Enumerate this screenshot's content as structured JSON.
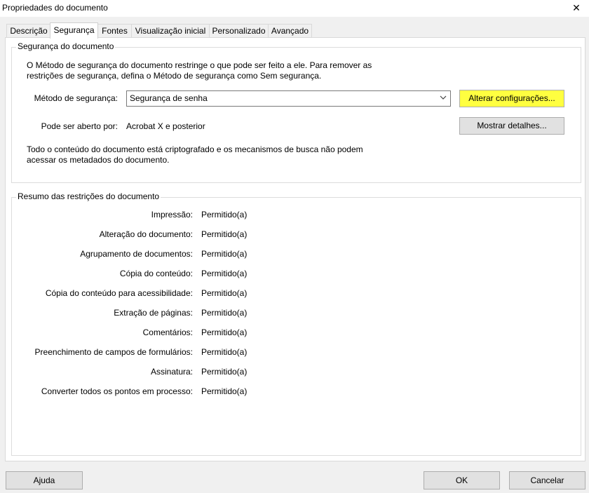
{
  "window": {
    "title": "Propriedades do documento",
    "close_glyph": "✕"
  },
  "tabs": [
    {
      "label": "Descrição"
    },
    {
      "label": "Segurança"
    },
    {
      "label": "Fontes"
    },
    {
      "label": "Visualização inicial"
    },
    {
      "label": "Personalizado"
    },
    {
      "label": "Avançado"
    }
  ],
  "security": {
    "group_title": "Segurança do documento",
    "description_line1": "O Método de segurança do documento restringe o que pode ser feito a ele. Para remover as",
    "description_line2": "restrições de segurança, defina o Método de segurança como Sem segurança.",
    "method_label": "Método de segurança:",
    "method_value": "Segurança de senha",
    "change_settings_label": "Alterar configurações...",
    "opened_by_label": "Pode ser aberto por:",
    "opened_by_value": "Acrobat X e posterior",
    "show_details_label": "Mostrar detalhes...",
    "encrypted_line1": "Todo o conteúdo do documento está criptografado e os mecanismos de busca não podem",
    "encrypted_line2": "acessar os metadados do documento."
  },
  "summary": {
    "group_title": "Resumo das restrições do documento",
    "rows": [
      {
        "label": "Impressão:",
        "value": "Permitido(a)"
      },
      {
        "label": "Alteração do documento:",
        "value": "Permitido(a)"
      },
      {
        "label": "Agrupamento de documentos:",
        "value": "Permitido(a)"
      },
      {
        "label": "Cópia do conteúdo:",
        "value": "Permitido(a)"
      },
      {
        "label": "Cópia do conteúdo para acessibilidade:",
        "value": "Permitido(a)"
      },
      {
        "label": "Extração de páginas:",
        "value": "Permitido(a)"
      },
      {
        "label": "Comentários:",
        "value": "Permitido(a)"
      },
      {
        "label": "Preenchimento de campos de formulários:",
        "value": "Permitido(a)"
      },
      {
        "label": "Assinatura:",
        "value": "Permitido(a)"
      },
      {
        "label": "Converter todos os pontos em processo:",
        "value": "Permitido(a)"
      }
    ]
  },
  "footer": {
    "help_label": "Ajuda",
    "ok_label": "OK",
    "cancel_label": "Cancelar"
  },
  "colors": {
    "highlight": "#ffff40"
  }
}
